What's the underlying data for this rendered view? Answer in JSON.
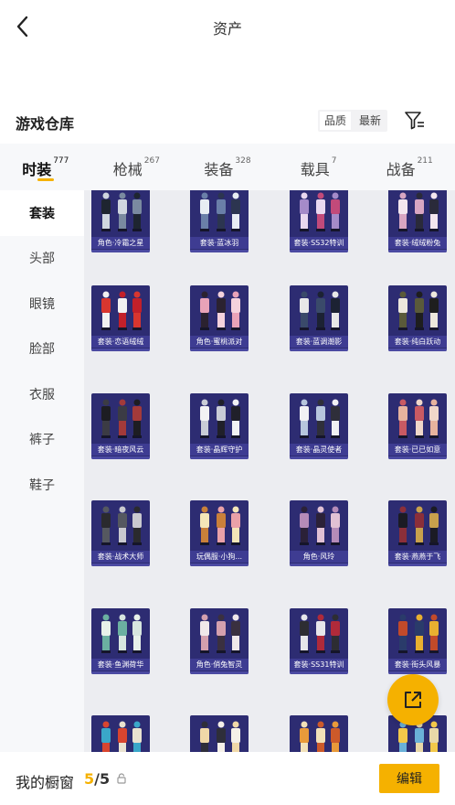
{
  "header": {
    "title": "资产"
  },
  "section": {
    "title": "游戏仓库"
  },
  "sort": {
    "options": [
      "品质",
      "最新"
    ]
  },
  "tabs": [
    {
      "label": "时装",
      "count": "777"
    },
    {
      "label": "枪械",
      "count": "267"
    },
    {
      "label": "装备",
      "count": "328"
    },
    {
      "label": "载具",
      "count": "7"
    },
    {
      "label": "战备",
      "count": "211"
    }
  ],
  "sidebar": {
    "items": [
      "套装",
      "头部",
      "眼镜",
      "脸部",
      "衣服",
      "裤子",
      "鞋子"
    ]
  },
  "items": [
    {
      "name": "角色·冷霜之星",
      "palette": [
        "#1e2530",
        "#cfd6df",
        "#7a8aa0"
      ]
    },
    {
      "name": "套装·蓝冰羽",
      "palette": [
        "#e8edf3",
        "#6a7fa8",
        "#2c3550"
      ]
    },
    {
      "name": "套装·SS32特训",
      "palette": [
        "#a58bc9",
        "#e9d8ef",
        "#c24a7a"
      ]
    },
    {
      "name": "套装·绒绒粉兔",
      "palette": [
        "#f3e6ee",
        "#d8a6c2",
        "#2a2a3a"
      ]
    },
    {
      "name": "套装·恋语绒绒",
      "palette": [
        "#d8362f",
        "#f1f1f1",
        "#c2202a"
      ]
    },
    {
      "name": "角色·蜜桃派对",
      "palette": [
        "#e9a3b8",
        "#2b2230",
        "#f4d2dc"
      ]
    },
    {
      "name": "套装·蓝调潮影",
      "palette": [
        "#e8e8e8",
        "#3a4a6a",
        "#1c2233"
      ]
    },
    {
      "name": "套装·纯白跃动",
      "palette": [
        "#ece7dc",
        "#5a5a3a",
        "#1e1e1e"
      ]
    },
    {
      "name": "套装·暗夜风云",
      "palette": [
        "#1d1d22",
        "#3b3b44",
        "#a33a3a"
      ]
    },
    {
      "name": "套装·晶辉守护",
      "palette": [
        "#f2f2f4",
        "#c9ccd6",
        "#20202a"
      ]
    },
    {
      "name": "套装·晶灵使者",
      "palette": [
        "#f1f1f4",
        "#b7c6dd",
        "#2f2f3a"
      ]
    },
    {
      "name": "套装·已已如意",
      "palette": [
        "#e7b39e",
        "#c95a63",
        "#f0d7c9"
      ]
    },
    {
      "name": "套装·战术大师",
      "palette": [
        "#2a2a2e",
        "#555860",
        "#c9c9cf"
      ]
    },
    {
      "name": "玩偶服·小狗...",
      "palette": [
        "#f5e6b8",
        "#c9803a",
        "#e9a1a8"
      ]
    },
    {
      "name": "角色·风玲",
      "palette": [
        "#b58bb8",
        "#2b2138",
        "#e1c1d4"
      ]
    },
    {
      "name": "套装·燕燕于飞",
      "palette": [
        "#1b1b24",
        "#8b2f3a",
        "#c8a14c"
      ]
    },
    {
      "name": "套装·鱼渊荷华",
      "palette": [
        "#e8f1ea",
        "#6bb0a1",
        "#d7e6df"
      ]
    },
    {
      "name": "角色·俏兔智灵",
      "palette": [
        "#f0e8ea",
        "#d4a0ae",
        "#3a3040"
      ]
    },
    {
      "name": "套装·SS31特训",
      "palette": [
        "#2d2d33",
        "#e6e6ea",
        "#b02a3a"
      ]
    },
    {
      "name": "套装·街头风暴",
      "palette": [
        "#c24a2a",
        "#2a3b6a",
        "#e8b030"
      ]
    },
    {
      "name": "",
      "palette": [
        "#3aa7c9",
        "#d8452f",
        "#e9e2d0"
      ]
    },
    {
      "name": "",
      "palette": [
        "#f0d8a8",
        "#2e2e3a",
        "#f5f0e8"
      ]
    },
    {
      "name": "",
      "palette": [
        "#e89a3a",
        "#f1e1b8",
        "#cc5a2a"
      ]
    },
    {
      "name": "",
      "palette": [
        "#f2c84a",
        "#6ab0d8",
        "#e8d8a8"
      ]
    }
  ],
  "showcase": {
    "label": "我的橱窗",
    "used": "5",
    "separator": "/",
    "total": "5"
  },
  "edit_label": "编辑",
  "colors": {
    "accent": "#f5b100",
    "card_bg": "#2d2c72",
    "card_caption": "#3e3c92",
    "grid_bg": "#ecedf1",
    "panel_bg": "#f7f8fa"
  },
  "icons": [
    "back-arrow-icon",
    "filter-icon",
    "share-external-icon",
    "lock-icon"
  ]
}
